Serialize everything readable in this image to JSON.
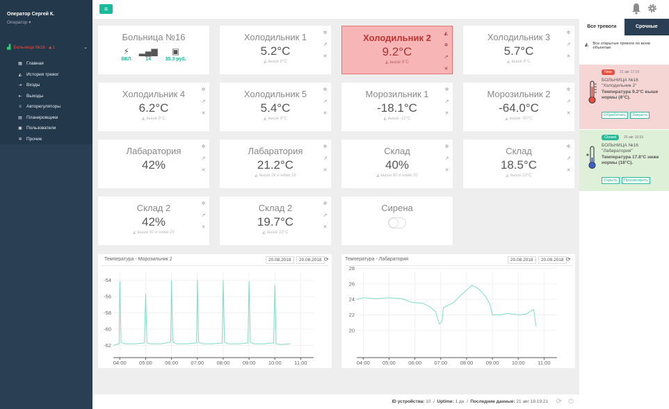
{
  "user": {
    "name": "Оператор Сергей К.",
    "role": "Оператор ▾"
  },
  "sidebar": {
    "hospital": {
      "label": "Больница №16",
      "alarm_count": "1"
    },
    "items": [
      {
        "icon": "grid-icon",
        "glyph": "▦",
        "label": "Главная"
      },
      {
        "icon": "bell-icon",
        "glyph": "▲",
        "label": "История тревог"
      },
      {
        "icon": "sign-in-icon",
        "glyph": "⇥",
        "label": "Входы"
      },
      {
        "icon": "sign-out-icon",
        "glyph": "⇤",
        "label": "Выходы"
      },
      {
        "icon": "sliders-icon",
        "glyph": "≡",
        "label": "Авторегуляторы"
      },
      {
        "icon": "calendar-icon",
        "glyph": "▤",
        "label": "Планировщики"
      },
      {
        "icon": "users-icon",
        "glyph": "▣",
        "label": "Пользователи"
      },
      {
        "icon": "gear-icon",
        "glyph": "✲",
        "label": "Прочие"
      }
    ]
  },
  "hospital_tile": {
    "title": "Больница №16",
    "stats": [
      {
        "icon": "power-plug-icon",
        "label": "ВКЛ"
      },
      {
        "icon": "signal-icon",
        "label": "14"
      },
      {
        "icon": "money-icon",
        "label": "35.3 руб."
      }
    ]
  },
  "tiles": [
    {
      "name": "Холодильник 1",
      "value": "5.2°C",
      "note": "выше 8°C",
      "alarm": false
    },
    {
      "name": "Холодильник 2",
      "value": "9.2°C",
      "note": "выше 8°C",
      "alarm": true
    },
    {
      "name": "Холодильник 3",
      "value": "5.7°C",
      "note": "выше 8°C",
      "alarm": false
    },
    {
      "name": "Холодильник 4",
      "value": "6.2°C",
      "note": "выше 8°C",
      "alarm": false
    },
    {
      "name": "Холодильник 5",
      "value": "5.4°C",
      "note": "выше 8°C",
      "alarm": false
    },
    {
      "name": "Морозильник 1",
      "value": "-18.1°C",
      "note": "выше -12°C",
      "alarm": false
    },
    {
      "name": "Морозильник 2",
      "value": "-64.0°C",
      "note": "выше -50°C",
      "alarm": false
    },
    {
      "name": "Лабаратория",
      "value": "42%",
      "note": "",
      "alarm": false
    },
    {
      "name": "Лабаратория",
      "value": "21.2°C",
      "note": "выше 24 и ниже 18",
      "alarm": false
    },
    {
      "name": "Склад",
      "value": "40%",
      "note": "выше 60 и ниже 20",
      "alarm": false
    },
    {
      "name": "Склад",
      "value": "18.5°C",
      "note": "выше 23°C",
      "alarm": false
    },
    {
      "name": "Склад 2",
      "value": "42%",
      "note": "выше 60 и ниже 20",
      "alarm": false
    },
    {
      "name": "Склад 2",
      "value": "19.7°C",
      "note": "выше 23°C",
      "alarm": false
    }
  ],
  "siren": {
    "name": "Сирена",
    "state": "off"
  },
  "chart_data": [
    {
      "type": "line",
      "title": "Температура - Морозильник 2",
      "date_from": "20.08.2018",
      "date_to": "20.08.2018",
      "x_ticks": [
        "04:00",
        "05:00",
        "06:00",
        "07:00",
        "08:00",
        "09:00",
        "10:00",
        "11:00"
      ],
      "y_ticks": [
        -54,
        -56,
        -58,
        -60,
        -62
      ],
      "ylim": [
        -63.5,
        -53
      ],
      "series": [
        {
          "color": "#7fdcc4",
          "x": [
            3.75,
            3.97,
            4.0,
            4.05,
            4.2,
            4.6,
            4.95,
            5.0,
            5.05,
            5.2,
            5.6,
            5.97,
            6.0,
            6.05,
            6.2,
            6.6,
            6.97,
            7.0,
            7.05,
            7.2,
            7.6,
            7.96,
            8.0,
            8.05,
            8.2,
            8.6,
            8.96,
            9.0,
            9.05,
            9.2,
            9.6,
            9.95,
            10.0,
            10.05,
            10.2,
            10.6
          ],
          "y": [
            -62.0,
            -61.8,
            -54.1,
            -61.6,
            -61.8,
            -61.8,
            -61.7,
            -55.6,
            -61.7,
            -61.8,
            -61.8,
            -61.6,
            -54.0,
            -61.6,
            -61.8,
            -61.8,
            -61.7,
            -53.9,
            -61.6,
            -61.8,
            -61.8,
            -61.7,
            -54.0,
            -61.6,
            -61.8,
            -61.8,
            -61.7,
            -54.1,
            -61.6,
            -61.8,
            -61.8,
            -61.7,
            -54.6,
            -61.8,
            -61.9,
            -61.8
          ]
        }
      ]
    },
    {
      "type": "line",
      "title": "Температура - Лабаратория",
      "date_from": "20.08.2018",
      "date_to": "20.08.2018",
      "x_ticks": [
        "04:00",
        "05:00",
        "06:00",
        "07:00",
        "08:00",
        "09:00",
        "10:00",
        "11:00"
      ],
      "y_ticks": [
        26,
        24,
        22,
        20,
        28
      ],
      "ylim": [
        16.5,
        27.5
      ],
      "series": [
        {
          "color": "#7fdcc4",
          "x": [
            3.75,
            4.0,
            4.5,
            5.0,
            5.5,
            5.9,
            6.3,
            6.6,
            6.8,
            6.95,
            7.05,
            7.1,
            7.2,
            7.5,
            7.8,
            8.2,
            8.35,
            8.55,
            8.75,
            8.9,
            9.0,
            9.3,
            9.6,
            10.0,
            10.3,
            10.5,
            10.6,
            10.68
          ],
          "y": [
            24.0,
            24.2,
            24.1,
            24.2,
            24.1,
            23.6,
            23.5,
            23.0,
            22.4,
            20.8,
            21.2,
            22.9,
            23.1,
            23.6,
            24.6,
            25.8,
            25.6,
            25.1,
            24.3,
            23.4,
            22.0,
            22.0,
            22.2,
            22.0,
            22.1,
            22.5,
            22.7,
            20.6
          ]
        }
      ]
    }
  ],
  "right_panel": {
    "tab_all": "Все тревоги",
    "tab_urgent": "Срочные",
    "info": "Все открытые тревоги по всем объектам",
    "alerts": [
      {
        "badge": "New",
        "time": "21 авг 17:10",
        "line1": "БОЛЬНИЦА №16",
        "line2": "\"Холодильник 2\"",
        "bold": "Температура 9.2°C выше нормы (8°C).",
        "btn1": "Обработать",
        "btn2": "Закрыть"
      },
      {
        "badge": "Closed",
        "time": "20 авг 16:59",
        "line1": "БОЛЬНИЦА №16",
        "line2": "\"Лабаратория\"",
        "bold": "Температура 17.8°C ниже нормы (18°C).",
        "btn1": "Скрыть",
        "btn2": "Просмотреть"
      }
    ]
  },
  "footer": {
    "device_label": "ID устройства:",
    "device_id": "10",
    "uptime_label": "Uptime:",
    "uptime": "1 дн",
    "last_label": "Последние данные:",
    "last": "21 авг 18:19:21"
  }
}
